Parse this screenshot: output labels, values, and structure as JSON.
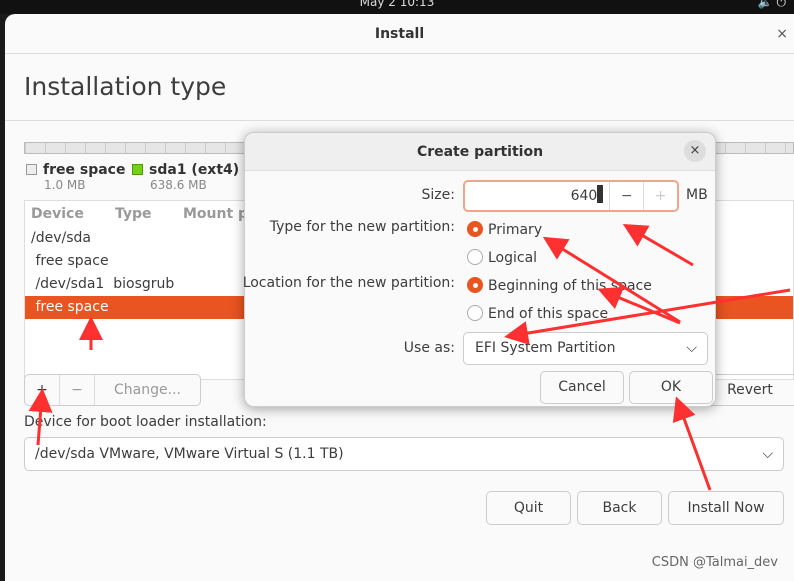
{
  "topbar": {
    "clock": "May 2  10:13",
    "icons": [
      "volume-icon",
      "power-icon"
    ]
  },
  "window": {
    "title": "Install",
    "close": "×"
  },
  "page": {
    "title": "Installation type"
  },
  "legend": [
    {
      "label": "free space",
      "size": "1.0 MB",
      "color": "#eeeeee"
    },
    {
      "label": "sda1 (ext4)",
      "size": "638.6 MB",
      "color": "#73d216"
    }
  ],
  "table": {
    "headers": [
      "Device",
      "Type",
      "Mount p"
    ],
    "rows": [
      {
        "device": "/dev/sda",
        "type": ""
      },
      {
        "device": " free space",
        "type": ""
      },
      {
        "device": " /dev/sda1",
        "type": "biosgrub"
      },
      {
        "device": " free space",
        "type": "",
        "selected": true
      }
    ]
  },
  "toolbar": {
    "add": "+",
    "remove": "−",
    "change": "Change...",
    "revert": "Revert"
  },
  "boot": {
    "label": "Device for boot loader installation:",
    "value": "/dev/sda   VMware, VMware Virtual S (1.1 TB)"
  },
  "buttons": {
    "quit": "Quit",
    "back": "Back",
    "install": "Install Now"
  },
  "dialog": {
    "title": "Create partition",
    "close": "×",
    "size_label": "Size:",
    "size_value": "640",
    "size_unit": "MB",
    "minus": "−",
    "plus": "+",
    "type_label": "Type for the new partition:",
    "type_options": [
      "Primary",
      "Logical"
    ],
    "type_selected": "Primary",
    "location_label": "Location for the new partition:",
    "location_options": [
      "Beginning of this space",
      "End of this space"
    ],
    "location_selected": "Beginning of this space",
    "useas_label": "Use as:",
    "useas_value": "EFI System Partition",
    "cancel": "Cancel",
    "ok": "OK"
  },
  "accent": "#e95420",
  "annotation_color": "#ff3030",
  "watermark": "CSDN @Talmai_dev"
}
